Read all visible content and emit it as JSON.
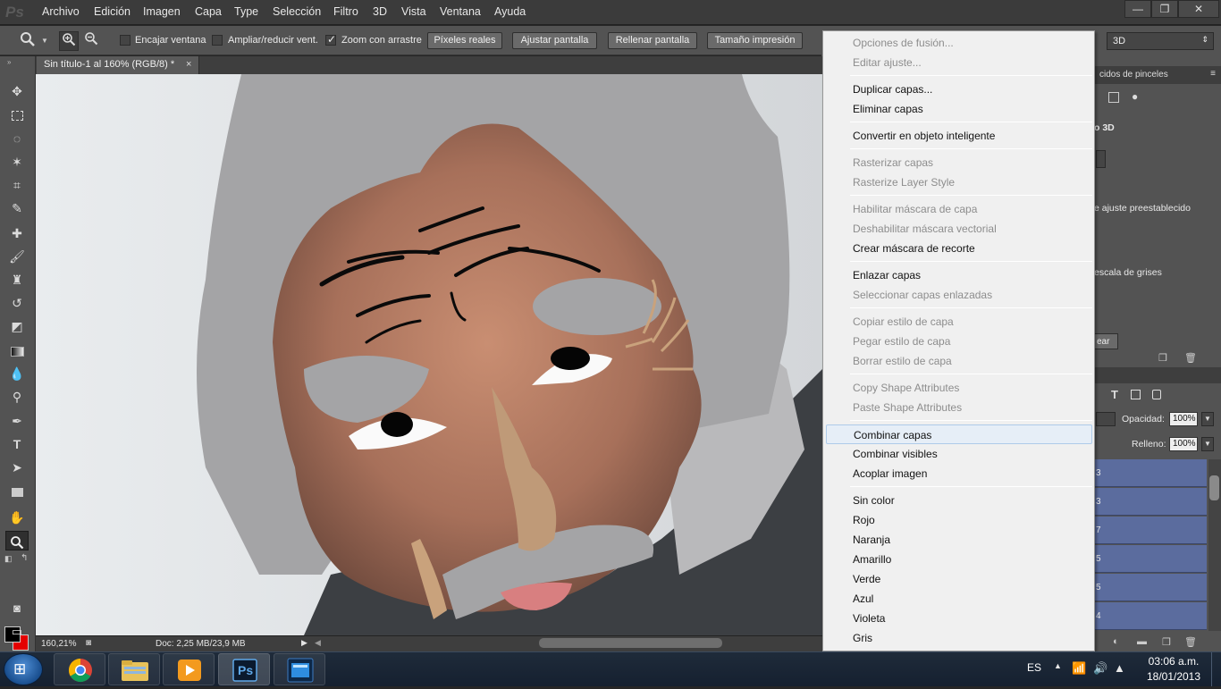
{
  "app": {
    "logo": "Ps",
    "menu": [
      "Archivo",
      "Edición",
      "Imagen",
      "Capa",
      "Type",
      "Selección",
      "Filtro",
      "3D",
      "Vista",
      "Ventana",
      "Ayuda"
    ],
    "window_controls": {
      "minimize": "—",
      "restore": "❐",
      "close": "✕"
    }
  },
  "options": {
    "encajar_label": "Encajar ventana",
    "encajar_checked": false,
    "ampliar_label": "Ampliar/reducir vent.",
    "ampliar_checked": false,
    "zoom_arrastre_label": "Zoom con arrastre",
    "zoom_arrastre_checked": true,
    "btn_pixeles": "Píxeles reales",
    "btn_ajustar": "Ajustar pantalla",
    "btn_rellenar": "Rellenar pantalla",
    "btn_tamano": "Tamaño impresión",
    "workspace_select": "3D"
  },
  "document": {
    "tab_title": "Sin título-1 al 160% (RGB/8) *",
    "tab_close": "×",
    "zoom": "160,21%",
    "doc_info": "Doc: 2,25 MB/23,9 MB"
  },
  "panels": {
    "header1": "cidos de pinceles",
    "label_3d": "o 3D",
    "preset_text": "e ajuste preestablecido",
    "gray_text": "escala de grises",
    "button_text": "ear",
    "opacity_label": "Opacidad:",
    "opacity_value": "100%",
    "fill_label": "Relleno:",
    "fill_value": "100%",
    "layer_rows": [
      "3",
      "3",
      "7",
      "5",
      "5",
      "4"
    ]
  },
  "context_menu": {
    "items": [
      {
        "label": "Opciones de fusión...",
        "enabled": false
      },
      {
        "label": "Editar ajuste...",
        "enabled": false
      },
      {
        "label": "Duplicar capas...",
        "enabled": true
      },
      {
        "label": "Eliminar capas",
        "enabled": true
      },
      {
        "label": "Convertir en objeto inteligente",
        "enabled": true
      },
      {
        "label": "Rasterizar capas",
        "enabled": false
      },
      {
        "label": "Rasterize Layer Style",
        "enabled": false
      },
      {
        "label": "Habilitar máscara de capa",
        "enabled": false
      },
      {
        "label": "Deshabilitar máscara vectorial",
        "enabled": false
      },
      {
        "label": "Crear máscara de recorte",
        "enabled": true
      },
      {
        "label": "Enlazar capas",
        "enabled": true
      },
      {
        "label": "Seleccionar capas enlazadas",
        "enabled": false
      },
      {
        "label": "Copiar estilo de capa",
        "enabled": false
      },
      {
        "label": "Pegar estilo de capa",
        "enabled": false
      },
      {
        "label": "Borrar estilo de capa",
        "enabled": false
      },
      {
        "label": "Copy Shape Attributes",
        "enabled": false
      },
      {
        "label": "Paste Shape Attributes",
        "enabled": false
      },
      {
        "label": "Combinar capas",
        "enabled": true,
        "highlighted": true
      },
      {
        "label": "Combinar visibles",
        "enabled": true
      },
      {
        "label": "Acoplar imagen",
        "enabled": true
      },
      {
        "label": "Sin color",
        "enabled": true
      },
      {
        "label": "Rojo",
        "enabled": true
      },
      {
        "label": "Naranja",
        "enabled": true
      },
      {
        "label": "Amarillo",
        "enabled": true
      },
      {
        "label": "Verde",
        "enabled": true
      },
      {
        "label": "Azul",
        "enabled": true
      },
      {
        "label": "Violeta",
        "enabled": true
      },
      {
        "label": "Gris",
        "enabled": true
      }
    ]
  },
  "taskbar": {
    "lang": "ES",
    "time": "03:06 a.m.",
    "date": "18/01/2013",
    "pinned": [
      "chrome-icon",
      "explorer-icon",
      "media-player-icon",
      "photoshop-icon",
      "app-icon"
    ],
    "ps_label": "Ps"
  },
  "colors": {
    "foreground": "#000000",
    "background": "#e50000",
    "menu_highlight": "#e6eef7"
  }
}
